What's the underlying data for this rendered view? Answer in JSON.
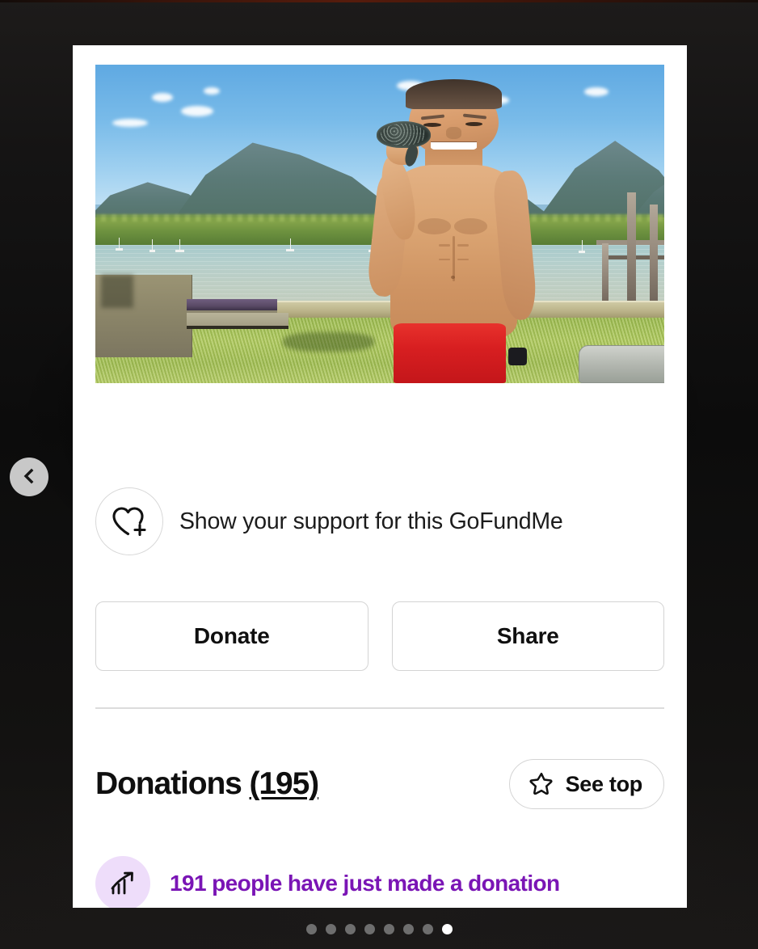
{
  "page": {
    "background_color": "#111111",
    "card_background": "#ffffff"
  },
  "media": {
    "alt": "campaign-photo",
    "description": "Shirtless man in red shorts holding a small turtle on a grassy waterfront with mountains and boats in the background"
  },
  "support": {
    "icon": "heart-plus-icon",
    "label": "Show your support for this GoFundMe"
  },
  "actions": {
    "donate_label": "Donate",
    "share_label": "Share"
  },
  "donations": {
    "title": "Donations",
    "count_label": "(195)",
    "count": 195,
    "see_top_label": "See top",
    "see_top_icon": "star-icon"
  },
  "activity": {
    "icon": "trending-up-icon",
    "message": "191 people have just made a donation",
    "count": 191,
    "accent_color": "#7a15b5",
    "badge_background": "#eeddfa"
  },
  "carousel": {
    "prev_label": "Previous",
    "prev_icon": "chevron-left-icon",
    "total_slides": 8,
    "active_slide": 8,
    "dots": [
      {
        "index": 1,
        "active": false
      },
      {
        "index": 2,
        "active": false
      },
      {
        "index": 3,
        "active": false
      },
      {
        "index": 4,
        "active": false
      },
      {
        "index": 5,
        "active": false
      },
      {
        "index": 6,
        "active": false
      },
      {
        "index": 7,
        "active": false
      },
      {
        "index": 8,
        "active": true
      }
    ]
  }
}
